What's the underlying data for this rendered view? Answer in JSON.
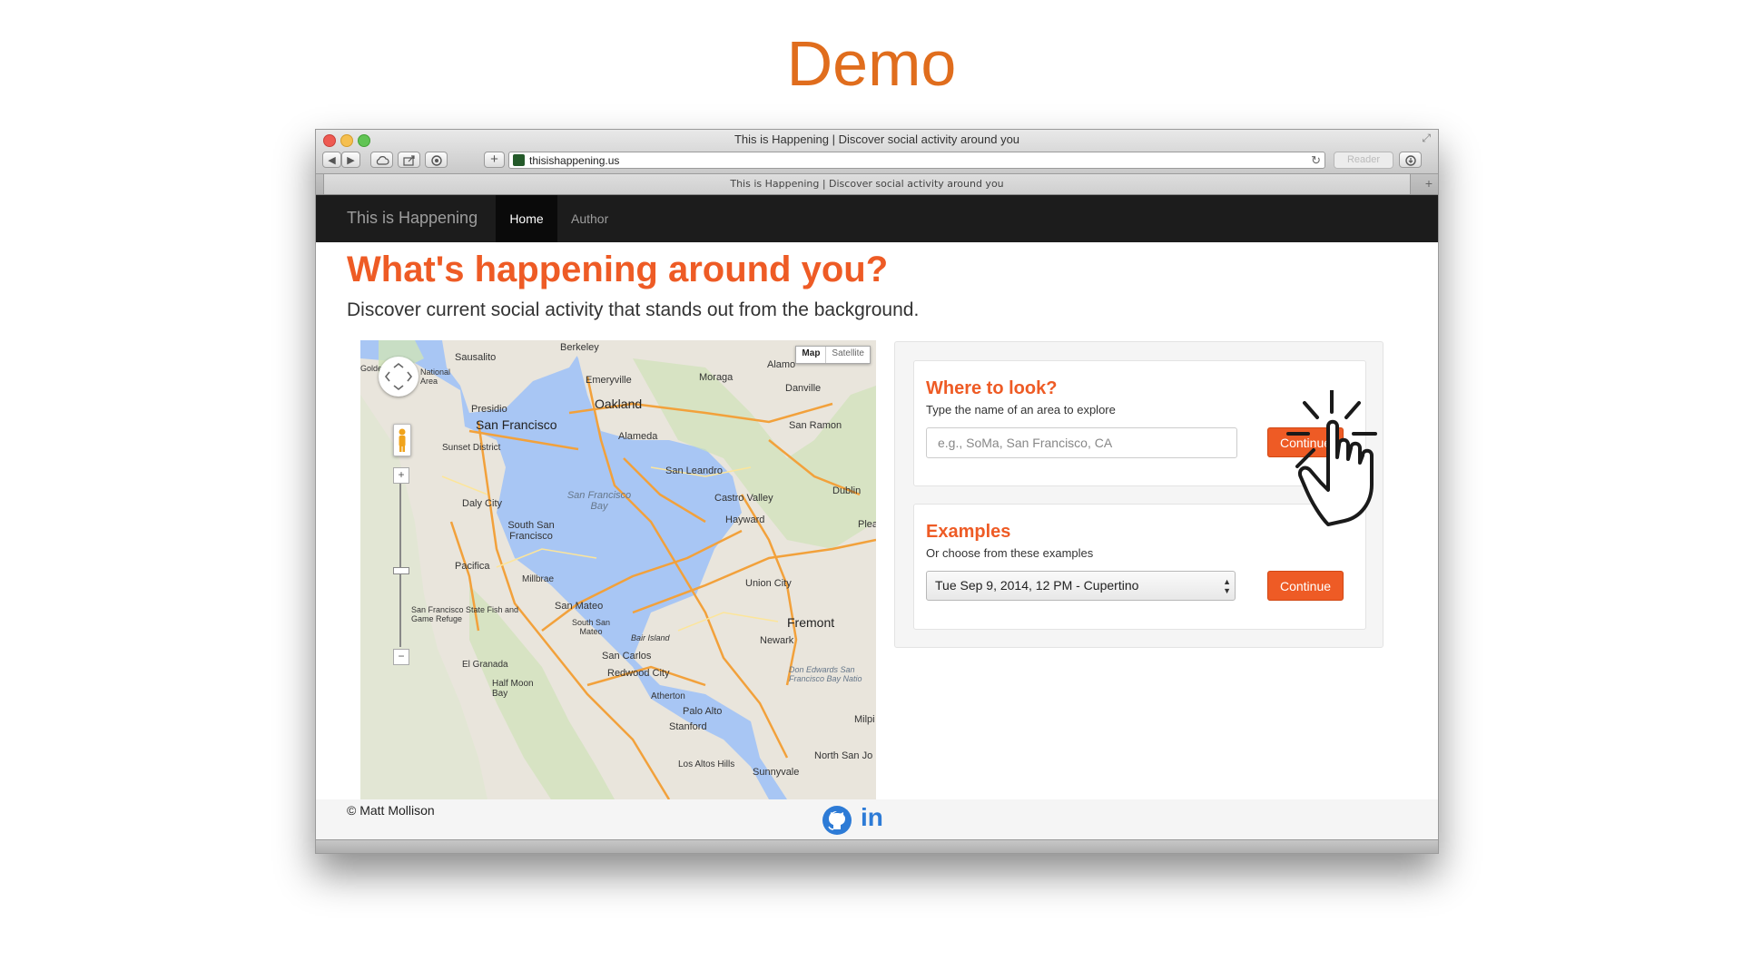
{
  "slide": {
    "title": "Demo"
  },
  "window": {
    "title": "This is Happening | Discover social activity around you"
  },
  "toolbar": {
    "back_icon": "◀",
    "forward_icon": "▶",
    "new_tab_icon": "+",
    "url": "thisishappening.us",
    "reader_label": "Reader",
    "reload_icon": "↻"
  },
  "tab": {
    "title": "This is Happening | Discover social activity around you"
  },
  "nav": {
    "brand": "This is Happening",
    "items": [
      {
        "label": "Home"
      },
      {
        "label": "Author"
      }
    ]
  },
  "hero": {
    "title": "What's happening around you?",
    "subtitle": "Discover current social activity that stands out from the background."
  },
  "map": {
    "mode_map": "Map",
    "mode_satellite": "Satellite",
    "labels": [
      "Berkeley",
      "Sausalito",
      "Emeryville",
      "Moraga",
      "Alamo",
      "Danville",
      "Oakland",
      "Presidio",
      "San Francisco",
      "Alameda",
      "San Ramon",
      "Sunset District",
      "San Leandro",
      "San Francisco Bay",
      "Daly City",
      "Castro Valley",
      "Dublin",
      "Hayward",
      "South San Francisco",
      "Pacifica",
      "Millbrae",
      "Union City",
      "San Mateo",
      "Fremont",
      "South San Mateo",
      "Bair Island",
      "Newark",
      "San Francisco State Fish and Game Refuge",
      "San Carlos",
      "El Granada",
      "Redwood City",
      "Don Edwards San Francisco Bay Natio",
      "Half Moon Bay",
      "Atherton",
      "Palo Alto",
      "Milpi",
      "Stanford",
      "North San Jo",
      "Los Altos Hills",
      "Sunnyvale",
      "Golde",
      "National Area",
      "Plea"
    ]
  },
  "search_card": {
    "title": "Where to look?",
    "subtitle": "Type the name of an area to explore",
    "placeholder": "e.g., SoMa, San Francisco, CA",
    "button": "Continue"
  },
  "examples_card": {
    "title": "Examples",
    "subtitle": "Or choose from these examples",
    "selected": "Tue Sep 9, 2014, 12 PM - Cupertino",
    "button": "Continue"
  },
  "footer": {
    "copyright": "© Matt Mollison",
    "linkedin": "in",
    "icons": [
      "github-icon",
      "linkedin-icon"
    ]
  },
  "colors": {
    "accent": "#ee5b25",
    "slide_title": "#e06d1d",
    "navbar": "#1c1c1c",
    "water": "#a8c6f4",
    "land": "#e9e5dc",
    "road": "#f2a13b",
    "linkedin": "#2d7bd6"
  }
}
